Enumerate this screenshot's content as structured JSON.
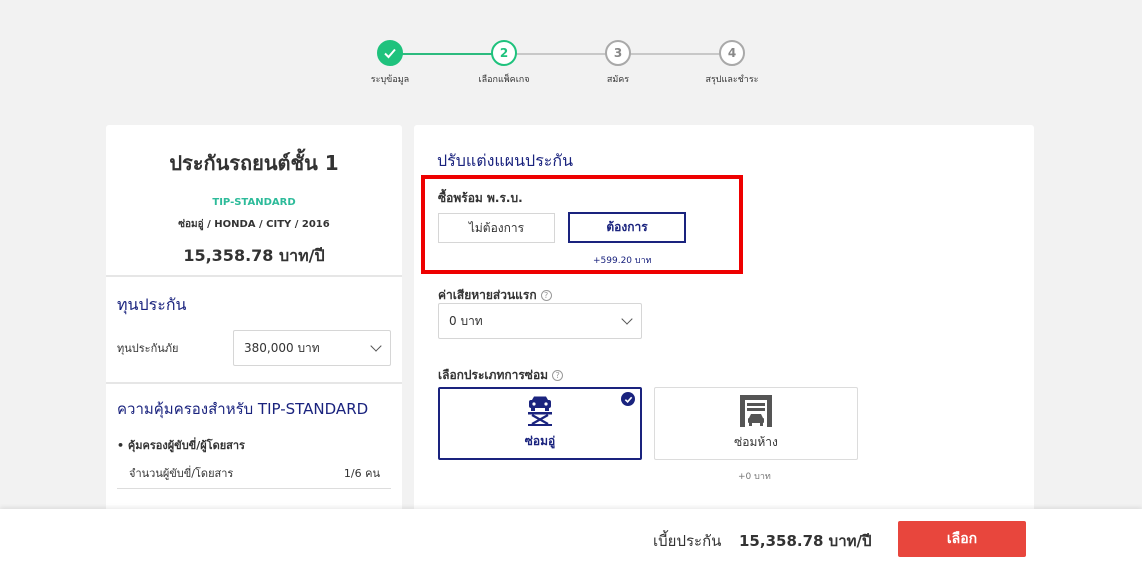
{
  "stepper": {
    "steps": [
      {
        "number": "",
        "label": "ระบุข้อมูล",
        "state": "done"
      },
      {
        "number": "2",
        "label": "เลือกแพ็คเกจ",
        "state": "active"
      },
      {
        "number": "3",
        "label": "สมัคร",
        "state": "pending"
      },
      {
        "number": "4",
        "label": "สรุปและชำระ",
        "state": "pending"
      }
    ]
  },
  "plan": {
    "title": "ประกันรถยนต์ชั้น 1",
    "code": "TIP-STANDARD",
    "car": "ซ่อมอู่ / HONDA / CITY / 2016",
    "price": "15,358.78 บาท/ปี"
  },
  "sum_insured": {
    "title": "ทุนประกัน",
    "label": "ทุนประกันภัย",
    "value": "380,000 บาท"
  },
  "coverage": {
    "title": "ความคุ้มครองสำหรับ TIP-STANDARD",
    "item": "คุ้มครองผู้ขับขี่/ผู้โดยสาร",
    "row_label": "จำนวนผู้ขับขี่/โดยสาร",
    "row_value": "1/6 คน"
  },
  "customize": {
    "title": "ปรับแต่งแผนประกัน",
    "compulsory_label": "ซื้อพร้อม พ.ร.บ.",
    "option_no": "ไม่ต้องการ",
    "option_yes": "ต้องการ",
    "compulsory_price": "+599.20 บาท",
    "deductible_label": "ค่าเสียหายส่วนแรก",
    "deductible_value": "0 บาท",
    "repair_label": "เลือกประเภทการซ่อม",
    "repair_garage": "ซ่อมอู่",
    "repair_dealer": "ซ่อมห้าง",
    "repair_dealer_price": "+0 บาท",
    "help_glyph": "?"
  },
  "footer": {
    "premium_label": "เบี้ยประกัน",
    "premium_value": "15,358.78 บาท/ปี",
    "select_button": "เลือก"
  },
  "colors": {
    "accent_navy": "#1a237e",
    "green": "#1fc27d",
    "highlight_red": "#ee0000",
    "cta_red": "#e8463d"
  }
}
